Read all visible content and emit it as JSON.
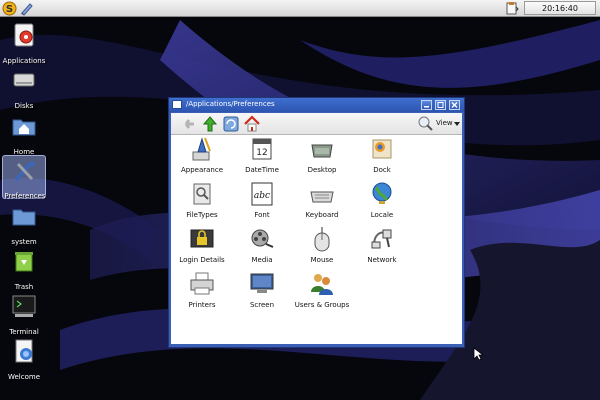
{
  "colors": {
    "panel": "#dedede",
    "title_bar": "#3566c4",
    "selected": "#9aa8e0",
    "wallpaper": "#0b0b18"
  },
  "top_panel": {
    "left_icons": [
      "s-logo-icon",
      "pencil-icon"
    ],
    "right_icons": [
      "clipboard-icon"
    ],
    "clock": "20:16:40"
  },
  "desktop": {
    "icons": [
      {
        "label": "Applications",
        "icon": "applications-icon"
      },
      {
        "label": "Disks",
        "icon": "disk-drive-icon"
      },
      {
        "label": "Home",
        "icon": "home-folder-icon"
      },
      {
        "label": "Preferences",
        "icon": "preferences-tools-icon",
        "selected": true
      },
      {
        "label": "system",
        "icon": "system-folder-icon"
      },
      {
        "label": "Trash",
        "icon": "trash-icon"
      },
      {
        "label": "Terminal",
        "icon": "terminal-icon"
      },
      {
        "label": "Welcome",
        "icon": "welcome-icon"
      }
    ]
  },
  "window": {
    "title": "/Applications/Preferences",
    "buttons": [
      "minimize",
      "maximize",
      "close"
    ],
    "toolbar": {
      "view_label": "View"
    },
    "items": [
      {
        "label": "Appearance",
        "icon": "appearance-icon"
      },
      {
        "label": "DateTime",
        "icon": "calendar-icon",
        "icon_text": "12"
      },
      {
        "label": "Desktop",
        "icon": "desktop-icon"
      },
      {
        "label": "Dock",
        "icon": "dock-icon"
      },
      {
        "label": "FileTypes",
        "icon": "filetypes-icon"
      },
      {
        "label": "Font",
        "icon": "font-icon",
        "icon_text": "abc"
      },
      {
        "label": "Keyboard",
        "icon": "keyboard-icon"
      },
      {
        "label": "Locale",
        "icon": "globe-icon"
      },
      {
        "label": "Login Details",
        "icon": "login-lock-icon"
      },
      {
        "label": "Media",
        "icon": "film-reel-icon"
      },
      {
        "label": "Mouse",
        "icon": "mouse-icon"
      },
      {
        "label": "Network",
        "icon": "network-icon"
      },
      {
        "label": "Printers",
        "icon": "printer-icon"
      },
      {
        "label": "Screen",
        "icon": "monitor-icon"
      },
      {
        "label": "Users & Groups",
        "icon": "users-groups-icon"
      }
    ]
  }
}
